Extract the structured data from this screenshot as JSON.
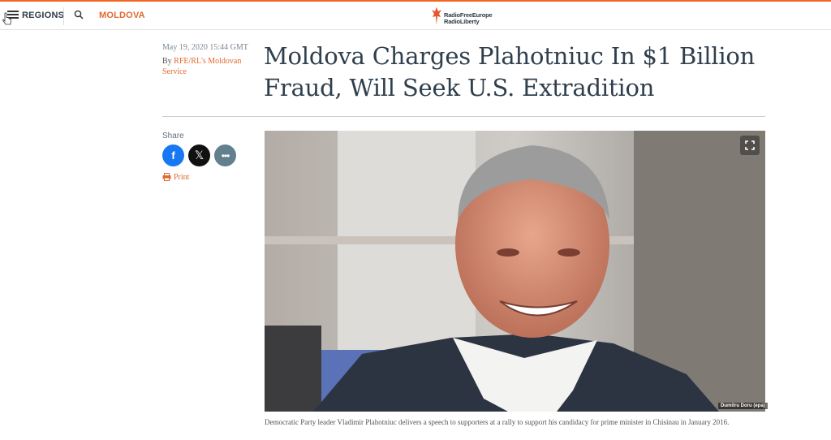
{
  "header": {
    "menu_icon": "hamburger-icon",
    "regions_label": "REGIONS",
    "search_icon": "search-icon",
    "section_label": "MOLDOVA",
    "logo": {
      "line1": "RadioFreeEurope",
      "line2": "RadioLiberty",
      "icon": "torch-icon",
      "accent_color": "#e4572e"
    }
  },
  "article": {
    "date": "May 19, 2020 15:44 GMT",
    "byline_prefix": "By",
    "author": "RFE/RL's Moldovan Service",
    "title": "Moldova Charges Plahotniuc In $1 Billion Fraud, Will Seek U.S. Extradition",
    "share_label": "Share",
    "share_buttons": [
      {
        "icon": "facebook-icon",
        "glyph": "f",
        "color": "#1877f2"
      },
      {
        "icon": "x-icon",
        "glyph": "𝕏",
        "color": "#111111"
      },
      {
        "icon": "more-icon",
        "glyph": "•••",
        "color": "#63808e"
      }
    ],
    "print_label": "Print",
    "print_icon": "printer-icon",
    "image": {
      "expand_icon": "expand-icon",
      "credit": "Dumitru Doru (epa)",
      "caption": "Democratic Party leader Vladimir Plahotniuc delivers a speech to supporters at a rally to support his candidacy for prime minister in Chisinau in January 2016."
    }
  },
  "colors": {
    "accent": "#e06a2e",
    "headline": "#2f3f4d",
    "top_border": "#f26522"
  }
}
